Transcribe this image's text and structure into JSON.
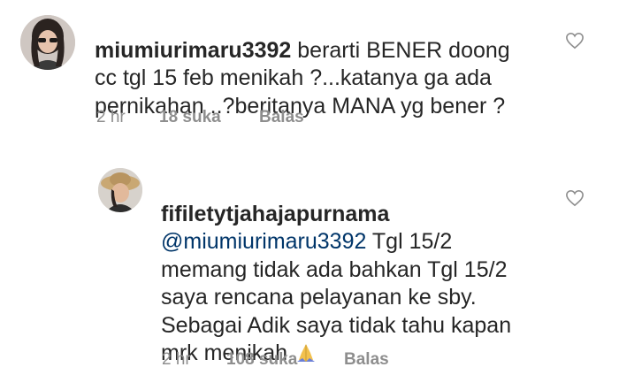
{
  "comments": [
    {
      "username": "miumiurimaru3392",
      "lines": [
        " berarti BENER doong",
        "cc tgl 15 feb menikah ?...katanya ga ada",
        "pernikahan ..?beritanya MANA yg bener ?"
      ],
      "time": "2 hr",
      "likes": "18 suka",
      "reply": "Balas",
      "like_icon": "heart-outline-icon"
    },
    {
      "username": "fifiletytjahajapurnama",
      "mention": "@miumiurimaru3392",
      "lines": [
        " Tgl 15/2",
        "memang tidak ada bahkan Tgl 15/2",
        "saya rencana pelayanan ke sby.",
        "Sebagai Adik saya tidak tahu kapan",
        "mrk menikah "
      ],
      "emoji": "folded-hands-icon",
      "time": "2 hr",
      "likes": "108 suka",
      "reply": "Balas",
      "like_icon": "heart-outline-icon"
    }
  ],
  "colors": {
    "text": "#262626",
    "mention": "#003569",
    "meta": "#8e8e8e"
  }
}
